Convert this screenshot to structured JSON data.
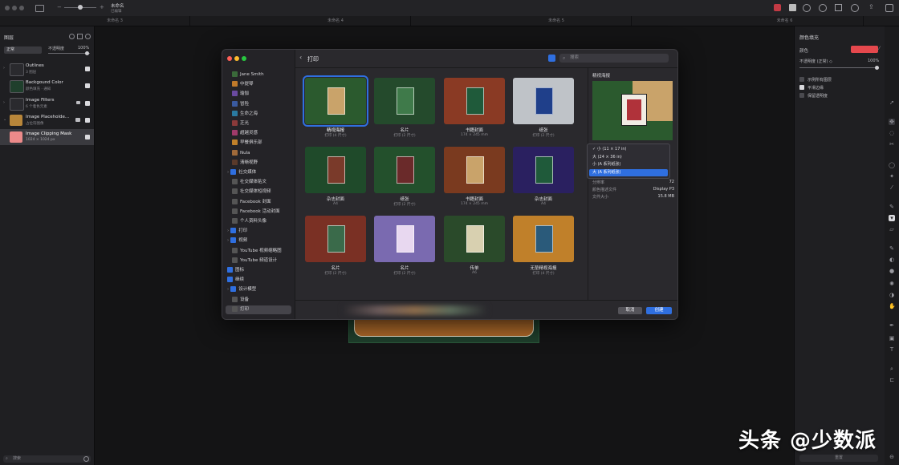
{
  "toolbar": {
    "doc_title": "未命名",
    "doc_sub": "已编辑"
  },
  "tabs": [
    "未命名 3",
    "未命名 4",
    "未命名 5",
    "未命名 6"
  ],
  "layers": {
    "title": "图层",
    "blend_mode": "正常",
    "opacity_label": "不透明度",
    "opacity_value": "100%",
    "items": [
      {
        "name": "Outlines",
        "sub": "3 图层"
      },
      {
        "name": "Backgound Color",
        "sub": "颜色填充 · 通知"
      },
      {
        "name": "Image Filters",
        "sub": "6 个着色元素"
      },
      {
        "name": "Image Placeholde...",
        "sub": "占位符图像"
      },
      {
        "name": "Image Clipping Mask",
        "sub": "1024 × 1024 px"
      }
    ],
    "search_placeholder": "搜索"
  },
  "fill": {
    "title": "颜色填充",
    "color_label": "颜色",
    "color_value": "#e5484d",
    "opacity_label": "不透明度 (正常) ◇",
    "opacity_value": "100%",
    "options": [
      "示例所有图层",
      "平滑边缘",
      "保留透明度"
    ],
    "bottom_label": "重置"
  },
  "dialog": {
    "title": "打印",
    "search_placeholder": "搜索",
    "sidebar": [
      {
        "label": "Jane Smith",
        "color": "#3a6a3a",
        "indent": 1
      },
      {
        "label": "中提琴",
        "color": "#c07a2a",
        "indent": 1
      },
      {
        "label": "瑜伽",
        "color": "#6a4aa0",
        "indent": 1
      },
      {
        "label": "冒险",
        "color": "#3a5aa0",
        "indent": 1
      },
      {
        "label": "生命之海",
        "color": "#2a7aa0",
        "indent": 1
      },
      {
        "label": "芝光",
        "color": "#8a3a3a",
        "indent": 1
      },
      {
        "label": "超越灵感",
        "color": "#a03a6a",
        "indent": 1
      },
      {
        "label": "早餐俱乐部",
        "color": "#c0802a",
        "indent": 1
      },
      {
        "label": "Nula",
        "color": "#a06a3a",
        "indent": 1
      },
      {
        "label": "清晰视野",
        "color": "#5a3a2a",
        "indent": 1
      },
      {
        "label": "社交媒体",
        "color": "#2f6fe0",
        "indent": 0,
        "group": true
      },
      {
        "label": "社交媒体贴文",
        "color": "#555",
        "indent": 1
      },
      {
        "label": "社交媒体短视频",
        "color": "#555",
        "indent": 1
      },
      {
        "label": "Facebook 封面",
        "color": "#555",
        "indent": 1
      },
      {
        "label": "Facebook 活动封面",
        "color": "#555",
        "indent": 1
      },
      {
        "label": "个人资料头像",
        "color": "#555",
        "indent": 1
      },
      {
        "label": "打印",
        "color": "#2f6fe0",
        "indent": 0,
        "group": true
      },
      {
        "label": "视频",
        "color": "#2f6fe0",
        "indent": 0,
        "group": true
      },
      {
        "label": "YouTube 视频缩略图",
        "color": "#555",
        "indent": 1
      },
      {
        "label": "YouTube 频道设计",
        "color": "#555",
        "indent": 1
      },
      {
        "label": "图标",
        "color": "#2f6fe0",
        "indent": 0
      },
      {
        "label": "继续",
        "color": "#2f6fe0",
        "indent": 0
      },
      {
        "label": "设计模型",
        "color": "#2f6fe0",
        "indent": 0,
        "group": true
      },
      {
        "label": "设备",
        "color": "#555",
        "indent": 1
      },
      {
        "label": "打印",
        "color": "#555",
        "indent": 1,
        "selected": true
      }
    ],
    "cards": [
      {
        "label": "精视海报",
        "sub": "打印 (4 尺寸)",
        "bg": "#2b5a2e",
        "fg": "#c9a36a",
        "selected": true
      },
      {
        "label": "名片",
        "sub": "打印 (2 尺寸)",
        "bg": "#244a2c",
        "fg": "#3f7a4a"
      },
      {
        "label": "书籍封面",
        "sub": "174 × 245 mm",
        "bg": "#8a3a24",
        "fg": "#1f5a3a"
      },
      {
        "label": "纸张",
        "sub": "打印 (2 尺寸)",
        "bg": "#bfc3c8",
        "fg": "#1f3f8a"
      },
      {
        "label": "杂志封面",
        "sub": "A4",
        "bg": "#1f4a2a",
        "fg": "#7a3a2a"
      },
      {
        "label": "纸张",
        "sub": "打印 (2 尺寸)",
        "bg": "#23502c",
        "fg": "#6a2a2a"
      },
      {
        "label": "书籍封面",
        "sub": "174 × 245 mm",
        "bg": "#7a3a1f",
        "fg": "#c9a36a"
      },
      {
        "label": "杂志封面",
        "sub": "A4",
        "bg": "#2a2060",
        "fg": "#1f5a3a"
      },
      {
        "label": "名片",
        "sub": "打印 (2 尺寸)",
        "bg": "#7a3024",
        "fg": "#3a6a4a"
      },
      {
        "label": "名片",
        "sub": "打印 (2 尺寸)",
        "bg": "#7a6ab0",
        "fg": "#e8d8f0"
      },
      {
        "label": "传单",
        "sub": "A6",
        "bg": "#2a4a2a",
        "fg": "#d8d0b0"
      },
      {
        "label": "无垫精视海报",
        "sub": "打印 (4 尺寸)",
        "bg": "#c0802a",
        "fg": "#2a5a7a"
      }
    ],
    "preview": {
      "title": "精视海报",
      "rows": [
        {
          "k": "分辨率",
          "v": "72"
        },
        {
          "k": "颜色描述文件",
          "v": "Display P3"
        },
        {
          "k": "文件大小",
          "v": "15.8 MB"
        }
      ]
    },
    "size_options": [
      {
        "label": "✓ 小 (11 × 17 in)"
      },
      {
        "label": "大 (24 × 36 in)"
      },
      {
        "label": "小 (A 系列纸张)"
      },
      {
        "label": "大 (A 系列纸张)",
        "highlight": true
      }
    ],
    "cancel_label": "取消",
    "create_label": "创建"
  },
  "watermark": "头条 @少数派",
  "colors": {
    "accent": "#2f6fe0",
    "dialog_bg": "#2a292d"
  }
}
